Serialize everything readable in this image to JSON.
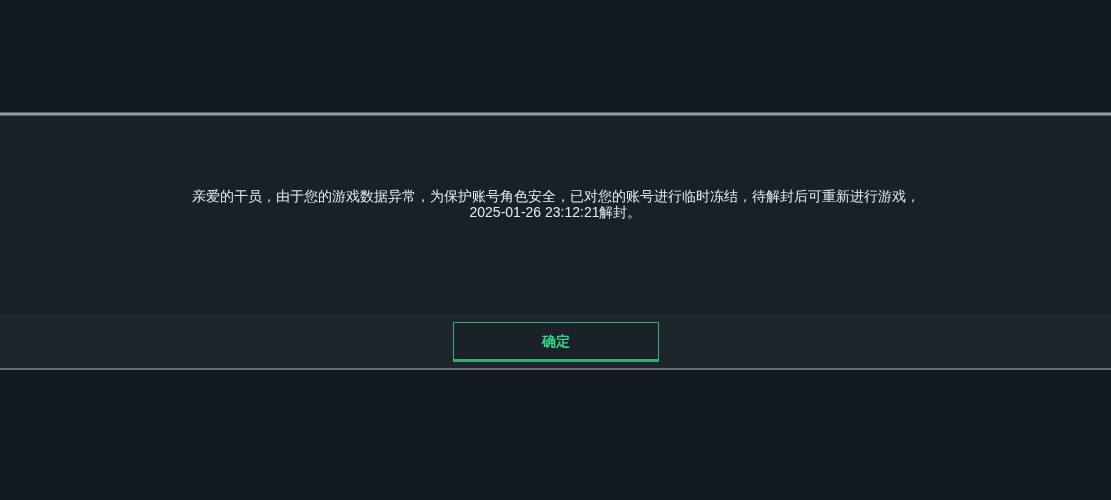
{
  "dialog": {
    "message": "亲爱的干员，由于您的游戏数据异常，为保护账号角色安全，已对您的账号进行临时冻结，待解封后可重新进行游戏，2025-01-26 23:12:21解封。",
    "buttons": [
      {
        "label": "确定",
        "kind": "primary"
      }
    ]
  }
}
